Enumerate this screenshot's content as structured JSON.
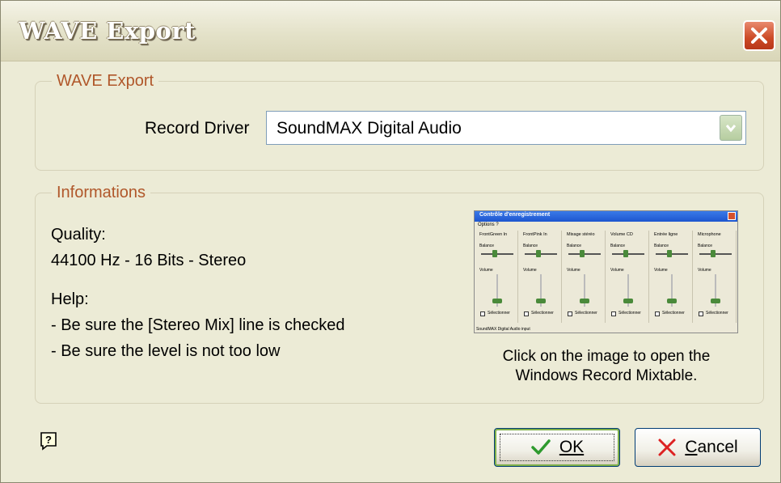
{
  "window": {
    "title": "WAVE Export"
  },
  "wave_export_group": {
    "legend": "WAVE Export",
    "record_driver_label": "Record Driver",
    "record_driver_value": "SoundMAX Digital Audio"
  },
  "informations_group": {
    "legend": "Informations",
    "quality_label": "Quality:",
    "quality_value": "44100 Hz - 16 Bits - Stereo",
    "help_label": "Help:",
    "help_line1": "- Be sure the [Stereo Mix] line is checked",
    "help_line2": "- Be sure the level is not too low",
    "mixer_caption_line1": "Click on the image to open the",
    "mixer_caption_line2": "Windows Record Mixtable."
  },
  "mixer_thumbnail": {
    "title": "Contrôle d'enregistrement",
    "menu": "Options  ?",
    "balance_label": "Balance",
    "volume_label": "Volume",
    "select_label": "Sélectionner",
    "status": "SoundMAX Digital Audio input",
    "columns": [
      "FrontGreen In",
      "FrontPink In",
      "Mixage stéréo",
      "Volume CD",
      "Entrée ligne",
      "Microphone"
    ]
  },
  "buttons": {
    "ok": "OK",
    "cancel": "Cancel"
  },
  "icons": {
    "close": "close-icon",
    "help": "help-icon",
    "combo_arrow": "chevron-down-icon",
    "ok_check": "check-icon",
    "cancel_x": "x-icon"
  },
  "colors": {
    "legend": "#b0572a",
    "window_bg": "#ecebd6",
    "close_red": "#cc4a26",
    "ok_check_green": "#2e9a2e",
    "cancel_x_red": "#d22"
  }
}
